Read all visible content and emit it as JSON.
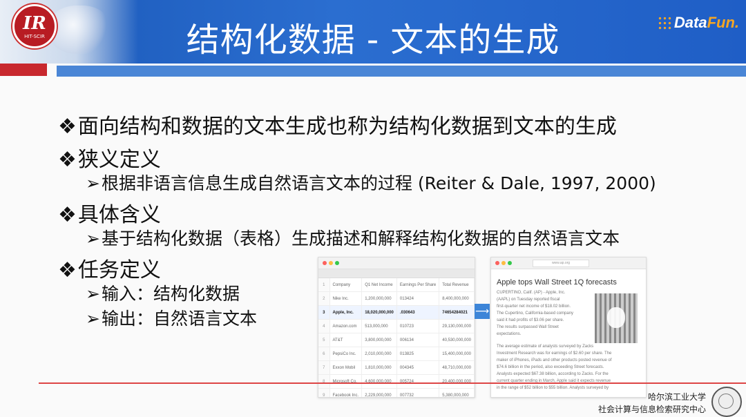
{
  "header": {
    "title": "结构化数据 - 文本的生成",
    "logo_text": "IR",
    "logo_sub": "HIT-SCIR",
    "brand_data": "Data",
    "brand_fun": "Fun."
  },
  "bullets": [
    {
      "marker": "❖",
      "text": "面向结构和数据的文本生成也称为结构化数据到文本的生成",
      "level": 1
    },
    {
      "marker": "❖",
      "text": "狭义定义",
      "level": 1
    },
    {
      "marker": "➢",
      "text": "根据非语言信息生成自然语言文本的过程 (Reiter & Dale, 1997, 2000)",
      "level": 2
    },
    {
      "marker": "❖",
      "text": "具体含义",
      "level": 1
    },
    {
      "marker": "➢",
      "text": "基于结构化数据（表格）生成描述和解释结构化数据的自然语言文本",
      "level": 2
    },
    {
      "marker": "❖",
      "text": "任务定义",
      "level": 1
    },
    {
      "marker": "➢",
      "text": "输入：结构化数据",
      "level": 2
    },
    {
      "marker": "➢",
      "text": "输出：自然语言文本",
      "level": 2
    }
  ],
  "sheet": {
    "headers": [
      "",
      "Company",
      "Q1 Net Income",
      "Earnings Per Share",
      "Total Revenue"
    ],
    "rows": [
      [
        "2",
        "Nike Inc.",
        "1,200,000,000",
        "013424",
        "8,400,000,000"
      ],
      [
        "3",
        "Apple, Inc.",
        "18,020,000,000",
        ".030643",
        "74654284021"
      ],
      [
        "4",
        "Amazon.com",
        "513,000,000",
        "010723",
        "29,130,000,000"
      ],
      [
        "5",
        "AT&T",
        "3,800,000,000",
        "006134",
        "40,530,000,000"
      ],
      [
        "6",
        "PepsiCo Inc.",
        "2,010,000,000",
        "013825",
        "15,400,000,000"
      ],
      [
        "7",
        "Exxon Mobil",
        "1,810,000,000",
        "004345",
        "48,710,000,000"
      ],
      [
        "8",
        "Microsoft Co.",
        "4,600,000,000",
        "005724",
        "20,400,000,000"
      ],
      [
        "9",
        "Facebook Inc.",
        "2,229,000,000",
        "007732",
        "5,380,000,000"
      ]
    ],
    "highlight_row": 1
  },
  "article": {
    "url": "www.ap.org",
    "title": "Apple tops Wall Street 1Q forecasts",
    "para1": "CUPERTINO, Calif. (AP) - Apple, Inc.\n(AAPL) on Tuesday reported fiscal\nfirst-quarter net income of $18.02 billion.\nThe Cupertino, California-based company\nsaid it had profits of $3.06 per share.\nThe results surpassed Wall Street\nexpectations.",
    "para2": "The average estimate of analysts surveyed by Zacks\nInvestment Research was for earnings of $2.60 per share. The\nmaker of iPhones, iPads and other products posted revenue of\n$74.6 billion in the period, also exceeding Street forecasts.\nAnalysts expected $67.38 billion, according to Zacks. For the\ncurrent quarter ending in March, Apple said it expects revenue\nin the range of $52 billion to $55 billion. Analysts surveyed by"
  },
  "footer": {
    "line1": "哈尔滨工业大学",
    "line2": "社会计算与信息检索研究中心"
  },
  "colors": {
    "header_blue": "#2b6ed0",
    "accent_red": "#c8282e",
    "brand_orange": "#f6a623"
  }
}
